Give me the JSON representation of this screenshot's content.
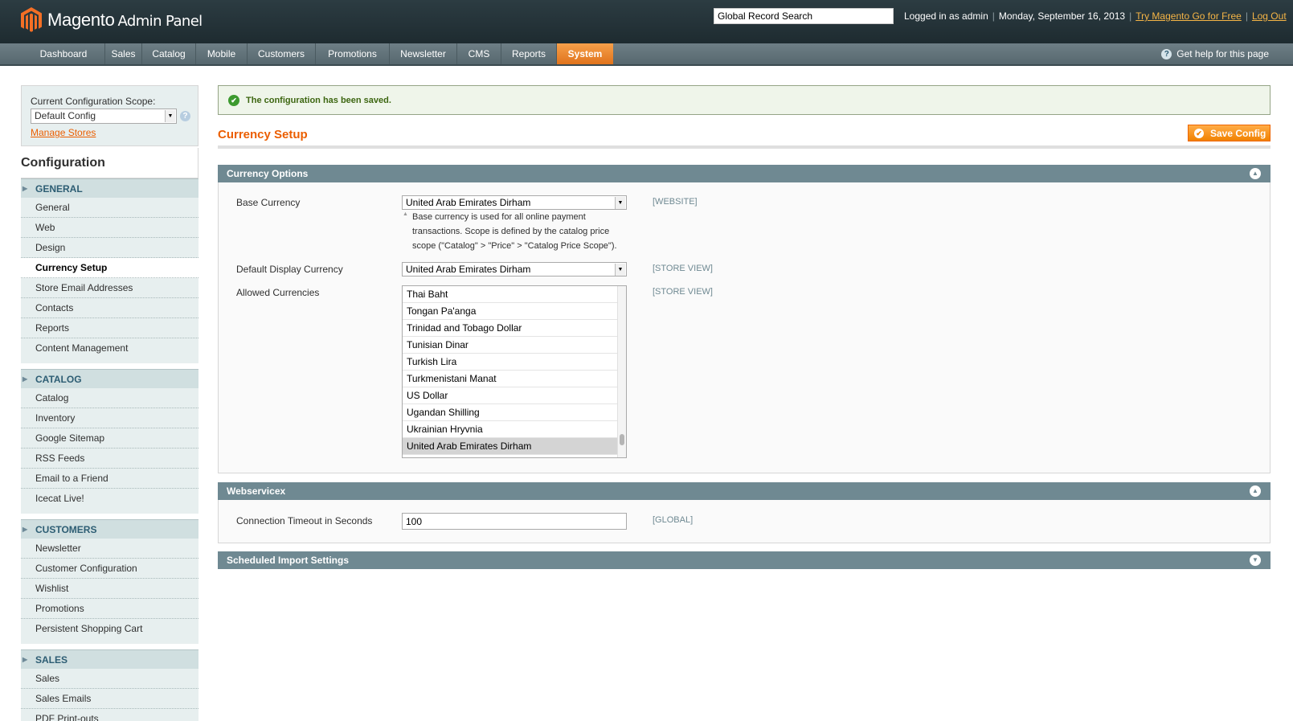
{
  "header": {
    "logo_text": "Magento",
    "logo_sub": "Admin Panel",
    "search_value": "Global Record Search",
    "logged_in": "Logged in as admin",
    "date": "Monday, September 16, 2013",
    "try_link": "Try Magento Go for Free",
    "logout": "Log Out"
  },
  "nav": {
    "items": [
      "Dashboard",
      "Sales",
      "Catalog",
      "Mobile",
      "Customers",
      "Promotions",
      "Newsletter",
      "CMS",
      "Reports",
      "System"
    ],
    "active": "System",
    "help": "Get help for this page"
  },
  "sidebar": {
    "scope_label": "Current Configuration Scope:",
    "scope_value": "Default Config",
    "manage_stores": "Manage Stores",
    "title": "Configuration",
    "groups": [
      {
        "title": "GENERAL",
        "items": [
          "General",
          "Web",
          "Design",
          "Currency Setup",
          "Store Email Addresses",
          "Contacts",
          "Reports",
          "Content Management"
        ]
      },
      {
        "title": "CATALOG",
        "items": [
          "Catalog",
          "Inventory",
          "Google Sitemap",
          "RSS Feeds",
          "Email to a Friend",
          "Icecat Live!"
        ]
      },
      {
        "title": "CUSTOMERS",
        "items": [
          "Newsletter",
          "Customer Configuration",
          "Wishlist",
          "Promotions",
          "Persistent Shopping Cart"
        ]
      },
      {
        "title": "SALES",
        "items": [
          "Sales",
          "Sales Emails",
          "PDF Print-outs"
        ]
      }
    ],
    "active_item": "Currency Setup"
  },
  "main": {
    "success_message": "The configuration has been saved.",
    "page_title": "Currency Setup",
    "save_button": "Save Config",
    "currency_options": {
      "title": "Currency Options",
      "base_currency_label": "Base Currency",
      "base_currency_value": "United Arab Emirates Dirham",
      "base_currency_scope": "[WEBSITE]",
      "base_currency_note": "Base currency is used for all online payment transactions. Scope is defined by the catalog price scope (\"Catalog\" > \"Price\" > \"Catalog Price Scope\").",
      "display_currency_label": "Default Display Currency",
      "display_currency_value": "United Arab Emirates Dirham",
      "display_currency_scope": "[STORE VIEW]",
      "allowed_label": "Allowed Currencies",
      "allowed_scope": "[STORE VIEW]",
      "allowed_options": [
        "Thai Baht",
        "Tongan Pa'anga",
        "Trinidad and Tobago Dollar",
        "Tunisian Dinar",
        "Turkish Lira",
        "Turkmenistani Manat",
        "US Dollar",
        "Ugandan Shilling",
        "Ukrainian Hryvnia",
        "United Arab Emirates Dirham"
      ],
      "allowed_selected": "United Arab Emirates Dirham"
    },
    "webservicex": {
      "title": "Webservicex",
      "timeout_label": "Connection Timeout in Seconds",
      "timeout_value": "100",
      "timeout_scope": "[GLOBAL]"
    },
    "scheduled_import": {
      "title": "Scheduled Import Settings"
    }
  },
  "colors": {
    "accent": "#eb5e00",
    "active_nav": "#f18200",
    "section_header": "#6f8992"
  }
}
